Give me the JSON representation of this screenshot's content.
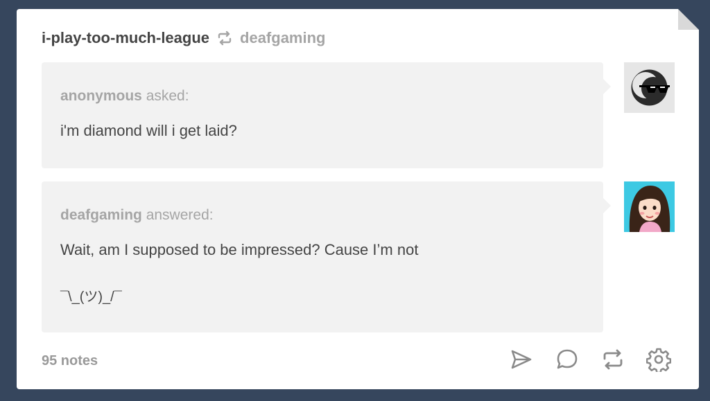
{
  "post": {
    "author": "i-play-too-much-league",
    "reblogged_from": "deafgaming",
    "ask": {
      "asker": "anonymous",
      "verb": "asked:",
      "question": "i'm diamond will i get laid?"
    },
    "answer": {
      "answerer": "deafgaming",
      "verb": "answered:",
      "line1": "Wait, am I supposed to be impressed? Cause I’m not",
      "line2": "¯\\_(ツ)_/¯"
    },
    "notes": "95 notes"
  },
  "icons": {
    "reblog_header": "reblog-icon",
    "share": "send-icon",
    "reply": "comment-icon",
    "reblog": "reblog-icon",
    "settings": "gear-icon"
  },
  "colors": {
    "background": "#36465d",
    "card": "#ffffff",
    "bubble": "#f2f2f2",
    "text": "#444444",
    "muted": "#a5a5a5"
  }
}
